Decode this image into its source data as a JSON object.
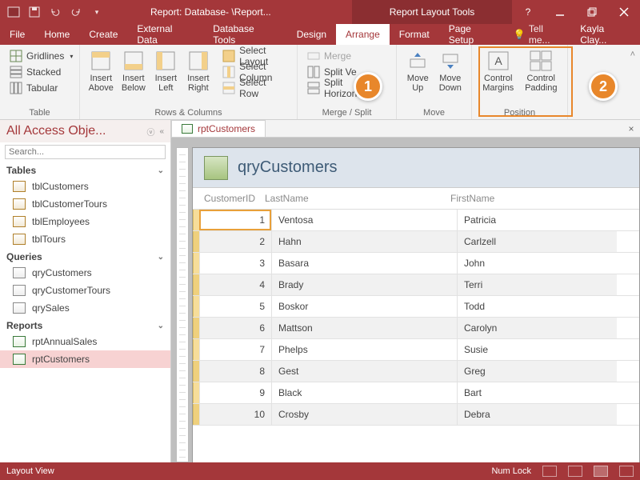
{
  "titlebar": {
    "title": "Report: Database- \\Report...",
    "context_title": "Report Layout Tools"
  },
  "tabs": {
    "file": "File",
    "home": "Home",
    "create": "Create",
    "external": "External Data",
    "dbtools": "Database Tools",
    "design": "Design",
    "arrange": "Arrange",
    "format": "Format",
    "pagesetup": "Page Setup",
    "tellme": "Tell me...",
    "user": "Kayla Clay..."
  },
  "ribbon": {
    "table": {
      "label": "Table",
      "gridlines": "Gridlines",
      "stacked": "Stacked",
      "tabular": "Tabular"
    },
    "rowscols": {
      "label": "Rows & Columns",
      "insert_above": "Insert\nAbove",
      "insert_below": "Insert\nBelow",
      "insert_left": "Insert\nLeft",
      "insert_right": "Insert\nRight",
      "select_layout": "Select Layout",
      "select_column": "Select Column",
      "select_row": "Select Row"
    },
    "mergesplit": {
      "label": "Merge / Split",
      "merge": "Merge",
      "split_vert": "Split Ve",
      "split_horiz": "Split Horizontally"
    },
    "move": {
      "label": "Move",
      "move_up": "Move\nUp",
      "move_down": "Move\nDown"
    },
    "position": {
      "label": "Position",
      "margins": "Control\nMargins",
      "padding": "Control\nPadding"
    }
  },
  "nav": {
    "title": "All Access Obje...",
    "search": "Search...",
    "tables": "Tables",
    "queries": "Queries",
    "reports": "Reports",
    "table_items": [
      "tblCustomers",
      "tblCustomerTours",
      "tblEmployees",
      "tblTours"
    ],
    "query_items": [
      "qryCustomers",
      "qryCustomerTours",
      "qrySales"
    ],
    "report_items": [
      "rptAnnualSales",
      "rptCustomers"
    ],
    "selected_report": "rptCustomers"
  },
  "doc": {
    "tab": "rptCustomers",
    "report_title": "qryCustomers",
    "columns": {
      "id": "CustomerID",
      "last": "LastName",
      "first": "FirstName"
    },
    "rows": [
      {
        "id": "1",
        "last": "Ventosa",
        "first": "Patricia"
      },
      {
        "id": "2",
        "last": "Hahn",
        "first": "Carlzell"
      },
      {
        "id": "3",
        "last": "Basara",
        "first": "John"
      },
      {
        "id": "4",
        "last": "Brady",
        "first": "Terri"
      },
      {
        "id": "5",
        "last": "Boskor",
        "first": "Todd"
      },
      {
        "id": "6",
        "last": "Mattson",
        "first": "Carolyn"
      },
      {
        "id": "7",
        "last": "Phelps",
        "first": "Susie"
      },
      {
        "id": "8",
        "last": "Gest",
        "first": "Greg"
      },
      {
        "id": "9",
        "last": "Black",
        "first": "Bart"
      },
      {
        "id": "10",
        "last": "Crosby",
        "first": "Debra"
      }
    ]
  },
  "statusbar": {
    "left": "Layout View",
    "numlock": "Num Lock"
  },
  "callouts": {
    "one": "1",
    "two": "2"
  }
}
